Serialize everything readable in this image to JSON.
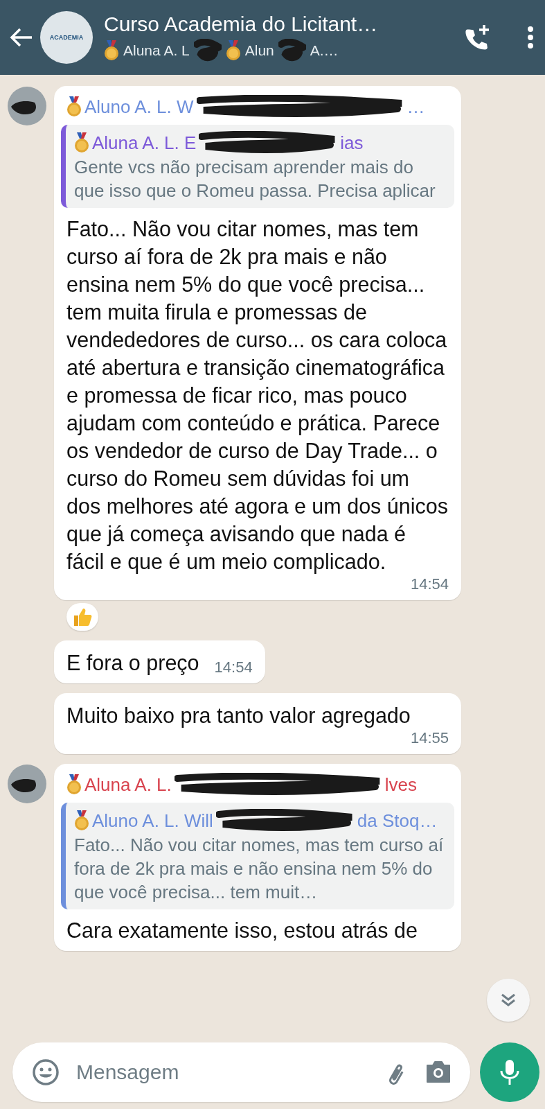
{
  "header": {
    "avatar_text": "ACADEMIA",
    "title": "Curso Academia do Licitant…",
    "subtitle": [
      {
        "text": "Aluna A. L",
        "medal": true,
        "redacted": true
      },
      {
        "text": "Alun",
        "medal": true,
        "redacted": true
      },
      {
        "text": "A.…",
        "medal": false,
        "redacted": false
      }
    ]
  },
  "messages": [
    {
      "avatar": true,
      "sender": {
        "start": "Aluno A. L. W",
        "end": "…",
        "color": "#6d8fdc"
      },
      "quote": {
        "sender": {
          "start": "Aluna A. L. E",
          "end": "ias",
          "color": "#7d5ad9"
        },
        "color": "#7d5ad9",
        "text": "Gente vcs não precisam aprender mais do que isso que o Romeu passa. Precisa aplicar"
      },
      "text": "Fato... Não vou citar nomes, mas tem curso aí fora de 2k pra mais e não ensina nem 5% do que você precisa... tem muita firula e promessas de vendededores de curso... os cara coloca até abertura e transição cinematográfica  e promessa de ficar rico, mas pouco ajudam com conteúdo e prática. Parece os vendedor de curso de Day Trade... o curso do Romeu sem dúvidas foi um dos melhores até agora e um dos únicos que já começa avisando que nada é fácil e que é um meio complicado.",
      "time": "14:54",
      "reacted": true
    },
    {
      "avatar": false,
      "text": "E fora o preço",
      "time": "14:54"
    },
    {
      "avatar": false,
      "text": "Muito baixo pra tanto valor agregado",
      "time": "14:55"
    },
    {
      "avatar": true,
      "sender": {
        "start": "Aluna A. L.",
        "end": "lves",
        "color": "#d8434e"
      },
      "quote": {
        "sender": {
          "start": "Aluno A. L. Will",
          "end": "da Stoq…",
          "color": "#6d8fdc"
        },
        "color": "#6d8fdc",
        "text": "Fato... Não vou citar nomes, mas tem curso aí fora de 2k pra mais e não ensina nem 5% do que você precisa... tem muit…"
      },
      "text": "Cara exatamente isso, estou atrás de"
    }
  ],
  "composer": {
    "placeholder": "Mensagem"
  }
}
